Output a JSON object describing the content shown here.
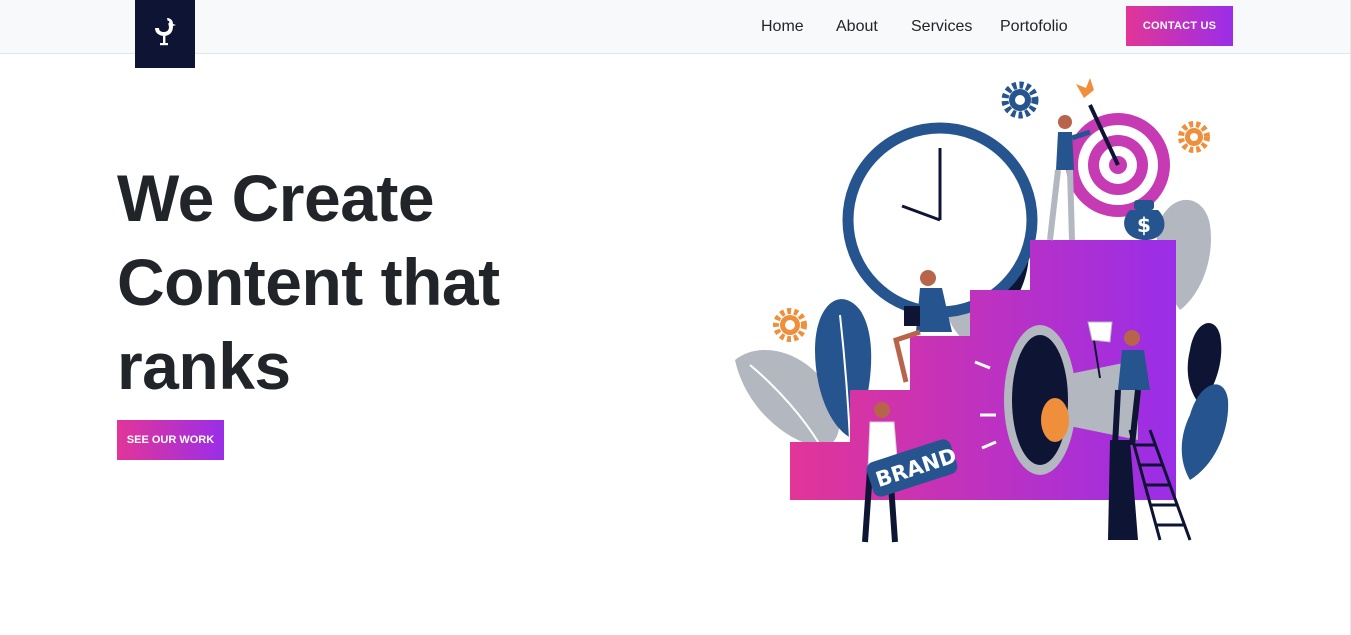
{
  "navbar": {
    "logo_icon": "bird-microphone-logo-icon",
    "links": [
      {
        "label": "Home"
      },
      {
        "label": "About"
      },
      {
        "label": "Services"
      },
      {
        "label": "Portofolio"
      }
    ],
    "contact_label": "CONTACT US"
  },
  "hero": {
    "title_lines": [
      "We Create",
      "Content that",
      "ranks"
    ],
    "cta_label": "SEE OUR WORK"
  },
  "illustration": {
    "sign_text": "BRAND",
    "money_symbol": "$"
  },
  "colors": {
    "accent_start": "#e23597",
    "accent_end": "#9a2ee8",
    "navy": "#0e1434",
    "blue": "#26548f",
    "orange": "#ef8f3b"
  }
}
